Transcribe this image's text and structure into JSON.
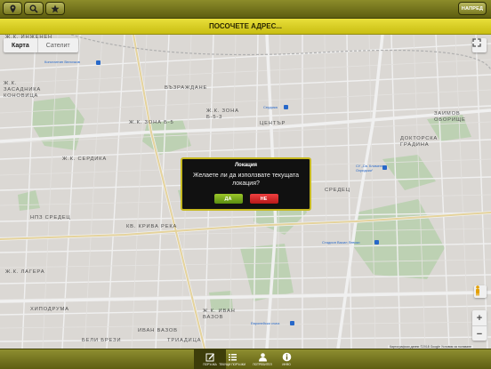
{
  "toolbar": {
    "left_buttons": [
      {
        "icon": "location-pin-icon"
      },
      {
        "icon": "search-icon"
      },
      {
        "icon": "star-icon"
      }
    ],
    "next_label": "НАПРЕД"
  },
  "title": "ПОСОЧЕТЕ АДРЕС...",
  "map": {
    "type_selected": "Карта",
    "type_other": "Сателит",
    "labels": {
      "injenen": "Ж.К. ИНЖЕНЕН",
      "konovitsa": "Ж.К.\nЗАСАДНИКА\nКОНОВИЦА",
      "vazrazhdane": "ВЪЗРАЖДАНЕ",
      "zona_b5": "Ж.К. ЗОНА Б-5",
      "zona_b53": "Ж.К. ЗОНА\nБ-5-3",
      "center": "ЦЕНТЪР",
      "zaimov": "ЗАИМОВ\nОБОРИЩЕ",
      "doctorska": "ДОКТОРСКА\nГРАДИНА",
      "serdika": "Ж.К. СЕРДИКА",
      "sredets_ne": "НПЗ СРЕДЕЦ",
      "sredets": "СРЕДЕЦ",
      "kriva_reka": "КВ. КРИВА РЕКА",
      "lagera": "Ж.К. ЛАГЕРА",
      "hipodruma": "ХИПОДРУМА",
      "beli_brezi": "БЕЛИ БРЕЗИ",
      "ivan_vazov": "Ж.К. ИВАН\nВАЗОВ",
      "ivan_vazov2": "ИВАН ВАЗОВ",
      "triaditsa": "ТРИАДИЦА"
    },
    "pois": {
      "konstantin": "Константин Величков",
      "serdika_st": "Сердика",
      "kliment": "СУ „Св. Климент\nОхридски“",
      "stadium": "Стадион Васил Левски",
      "evropeyski": "Европейски съюз"
    },
    "attribution": "Картографски данни ©2018 Google   Условия за ползване"
  },
  "dialog": {
    "title": "Локация",
    "message": "Желаете ли да използвате текущата локация?",
    "yes_label": "ДА",
    "no_label": "НЕ"
  },
  "tabs": [
    {
      "label": "ПОРЪЧКА",
      "icon": "order-icon",
      "active": true
    },
    {
      "label": "ТЕКУЩИ ПОРЪЧКИ",
      "icon": "list-icon",
      "active": false
    },
    {
      "label": "ПОТРЕБИТЕЛ",
      "icon": "user-icon",
      "active": false
    },
    {
      "label": "ИНФО",
      "icon": "info-icon",
      "active": false
    }
  ],
  "colors": {
    "title_bar": "#d9cf20",
    "toolbar": "#6f6f1a",
    "yes_button": "#7bb01c",
    "no_button": "#d42a2a"
  }
}
